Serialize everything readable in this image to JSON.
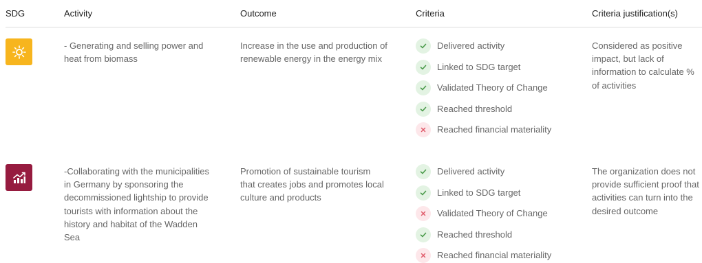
{
  "headers": {
    "sdg": "SDG",
    "activity": "Activity",
    "outcome": "Outcome",
    "criteria": "Criteria",
    "justification": "Criteria justification(s)"
  },
  "colors": {
    "sdg7": "#F7B51E",
    "sdg8": "#961B3F",
    "check_bg": "#e3f3e3",
    "check": "#4a9a4a",
    "cross_bg": "#fde7ea",
    "cross": "#e05a6a"
  },
  "rows": [
    {
      "sdg_icon": "sun-energy-icon",
      "activity": [
        "- Generating and selling power and",
        "heat from biomass"
      ],
      "outcome": [
        "Increase in the use and production of",
        "renewable energy in the energy mix"
      ],
      "criteria": [
        {
          "label": "Delivered activity",
          "status": "check-icon"
        },
        {
          "label": "Linked to SDG target",
          "status": "check-icon"
        },
        {
          "label": "Validated Theory of Change",
          "status": "check-icon"
        },
        {
          "label": "Reached threshold",
          "status": "check-icon"
        },
        {
          "label": "Reached financial materiality",
          "status": "cross-icon"
        }
      ],
      "justification": [
        "Considered as positive",
        "impact, but lack of",
        "information to calculate %",
        "of activities"
      ]
    },
    {
      "sdg_icon": "growth-chart-icon",
      "activity": [
        "-Collaborating with the municipalities",
        "in Germany by sponsoring the",
        "decommissioned lightship to provide",
        "tourists with information about the",
        "history and habitat of the Wadden",
        "Sea"
      ],
      "outcome": [
        "Promotion of sustainable tourism",
        "that creates jobs and promotes local",
        "culture and products"
      ],
      "criteria": [
        {
          "label": "Delivered activity",
          "status": "check-icon"
        },
        {
          "label": "Linked to SDG target",
          "status": "check-icon"
        },
        {
          "label": "Validated Theory of Change",
          "status": "cross-icon"
        },
        {
          "label": "Reached threshold",
          "status": "check-icon"
        },
        {
          "label": "Reached financial materiality",
          "status": "cross-icon"
        }
      ],
      "justification": [
        "The organization does not",
        "provide sufficient proof that",
        "activities can turn into the",
        "desired outcome"
      ]
    }
  ]
}
